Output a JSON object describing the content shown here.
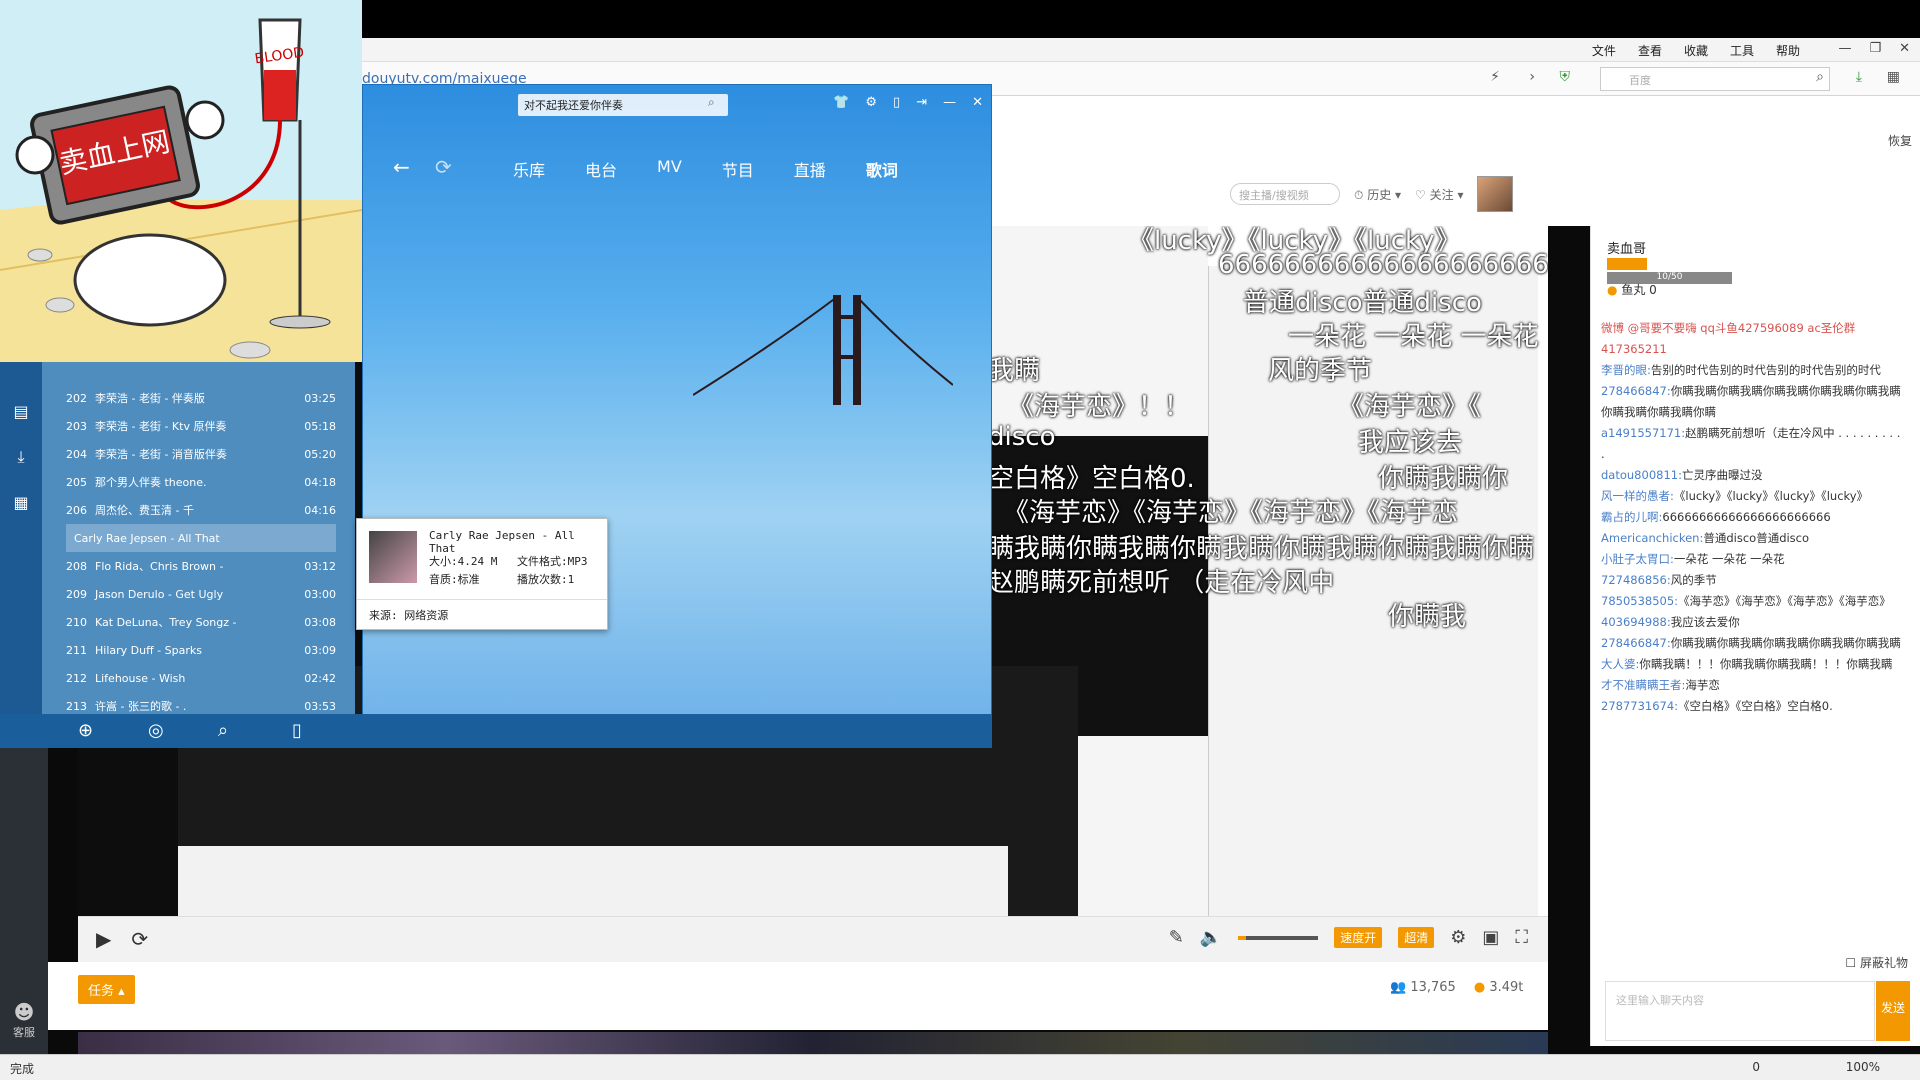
{
  "browser": {
    "menus": [
      "文件",
      "查看",
      "收藏",
      "工具",
      "帮助"
    ],
    "url": "douyutv.com/maixuege",
    "search_placeholder": "百度",
    "restore_label": "恢复"
  },
  "page": {
    "search_placeholder": "搜主播/搜视频",
    "history": "历史",
    "follow": "关注"
  },
  "danmu": [
    "《lucky》《lucky》《lucky》",
    "66666666666666666666666",
    "普通disco普通disco",
    "一朵花 一朵花 一朵花",
    "风的季节",
    "《海芋恋》《",
    "《海芋恋》！！",
    "我瞒",
    "disco",
    "空白格》空白格0.",
    "我应该去",
    "《海芋恋》《海芋恋》《海芋恋》《海芋恋",
    "你瞒我瞒你",
    "瞒我瞒你瞒我瞒你瞒我瞒你瞒我瞒你瞒我瞒你瞒",
    "赵鹏瞒死前想听 （走在冷风中",
    "你瞒我"
  ],
  "controls": {
    "speed_btn": "速度开",
    "hd_btn": "超清"
  },
  "task_btn": "任务",
  "stats": {
    "viewers": "13,765",
    "weight": "3.49t"
  },
  "chat": {
    "host": "卖血哥",
    "level_progress": "10/50",
    "fish": "鱼丸 0",
    "messages": [
      {
        "user": "微博 @哥要不要嗨 qq斗鱼427596089 ac圣伦群 417365211",
        "text": "",
        "red": true
      },
      {
        "user": "李晋的眼:",
        "text": "告别的时代告别的时代告别的时代告别的时代"
      },
      {
        "user": "278466847:",
        "text": "你瞒我瞒你瞒我瞒你瞒我瞒你瞒我瞒你瞒我瞒你瞒我瞒你瞒我瞒你瞒"
      },
      {
        "user": "a1491557171:",
        "text": "赵鹏瞒死前想听（走在冷风中 . . . . . . . . . ."
      },
      {
        "user": "datou800811:",
        "text": "亡灵序曲曝过没"
      },
      {
        "user": "风一样的愚者:",
        "text": "《lucky》《lucky》《lucky》《lucky》"
      },
      {
        "user": "霸占的儿啊:",
        "text": "66666666666666666666666"
      },
      {
        "user": "Americanchicken:",
        "text": "普通disco普通disco"
      },
      {
        "user": "小肚子太胃口:",
        "text": "一朵花 一朵花 一朵花"
      },
      {
        "user": "727486856:",
        "text": "风的季节"
      },
      {
        "user": "7850538505:",
        "text": "《海芋恋》《海芋恋》《海芋恋》《海芋恋》"
      },
      {
        "user": "403694988:",
        "text": "我应该去爱你"
      },
      {
        "user": "278466847:",
        "text": "你瞒我瞒你瞒我瞒你瞒我瞒你瞒我瞒你瞒我瞒"
      },
      {
        "user": "大人婆:",
        "text": "你瞒我瞒！！！你瞒我瞒你瞒我瞒！！！你瞒我瞒"
      },
      {
        "user": "才不准瞒瞒王者:",
        "text": "海芋恋"
      },
      {
        "user": "2787731674:",
        "text": "《空白格》《空白格》空白格0."
      }
    ],
    "gift_toggle": "屏蔽礼物",
    "input_placeholder": "这里输入聊天内容",
    "send": "发送"
  },
  "sticker": {
    "sign": "卖血上网",
    "bag": "BLOOD"
  },
  "player": {
    "search_value": "对不起我还爱你伴奏",
    "nav": [
      "乐库",
      "电台",
      "MV",
      "节目",
      "直播",
      "歌词"
    ],
    "list": [
      {
        "no": "202",
        "title": "李荣浩 - 老街 - 伴奏版",
        "time": "03:25"
      },
      {
        "no": "203",
        "title": "李荣浩 - 老街 - Ktv 原伴奏",
        "time": "05:18"
      },
      {
        "no": "204",
        "title": "李荣浩 - 老街 - 消音版伴奏",
        "time": "05:20"
      },
      {
        "no": "205",
        "title": "那个男人伴奏 theone.",
        "time": "04:18"
      },
      {
        "no": "206",
        "title": "周杰伦、费玉清 - 千",
        "time": "04:16"
      },
      {
        "no": "",
        "title": "Carly Rae Jepsen - All That",
        "time": ""
      },
      {
        "no": "208",
        "title": "Flo Rida、Chris Brown -",
        "time": "03:12"
      },
      {
        "no": "209",
        "title": "Jason Derulo - Get Ugly",
        "time": "03:00"
      },
      {
        "no": "210",
        "title": "Kat DeLuna、Trey Songz -",
        "time": "03:08"
      },
      {
        "no": "211",
        "title": "Hilary Duff - Sparks",
        "time": "03:09"
      },
      {
        "no": "212",
        "title": "Lifehouse - Wish",
        "time": "02:42"
      },
      {
        "no": "213",
        "title": "许嵩 - 张三的歌 - .",
        "time": "03:53"
      }
    ],
    "popup": {
      "title": "Carly Rae Jepsen - All That",
      "size": "大小:4.24 M",
      "format": "文件格式:MP3",
      "quality": "音质:标准",
      "plays": "播放次数:1",
      "source": "来源: 网络资源"
    }
  },
  "sidebar_label": "客服",
  "status": {
    "left": "完成",
    "zoom": "100%",
    "count": "0"
  }
}
